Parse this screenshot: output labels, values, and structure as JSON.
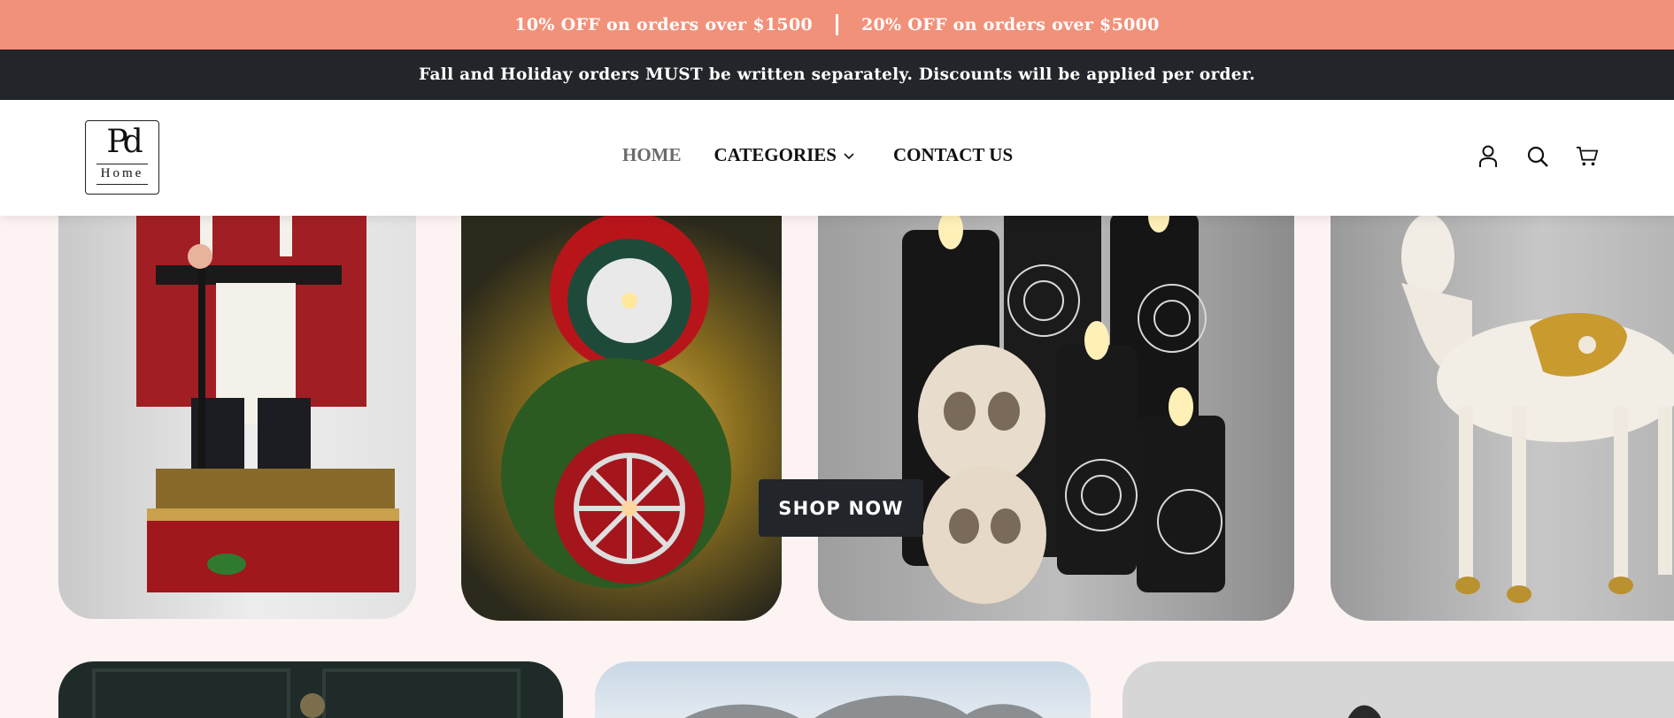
{
  "promo": {
    "left": "10% OFF on orders over $1500",
    "right": "20% OFF on orders over $5000"
  },
  "notice": "Fall and Holiday orders MUST be written separately. Discounts will be applied per order.",
  "logo": {
    "monogram": "Pd",
    "word": "Home"
  },
  "nav": {
    "home": "HOME",
    "categories": "CATEGORIES",
    "contact": "CONTACT US"
  },
  "icons": [
    "user-icon",
    "search-icon",
    "cart-icon"
  ],
  "hero": {
    "cta": "SHOP NOW"
  },
  "colors": {
    "promo_bg": "#f2917a",
    "notice_bg": "#222529",
    "page_bg": "#fdf3f3",
    "button_bg": "#222529"
  }
}
